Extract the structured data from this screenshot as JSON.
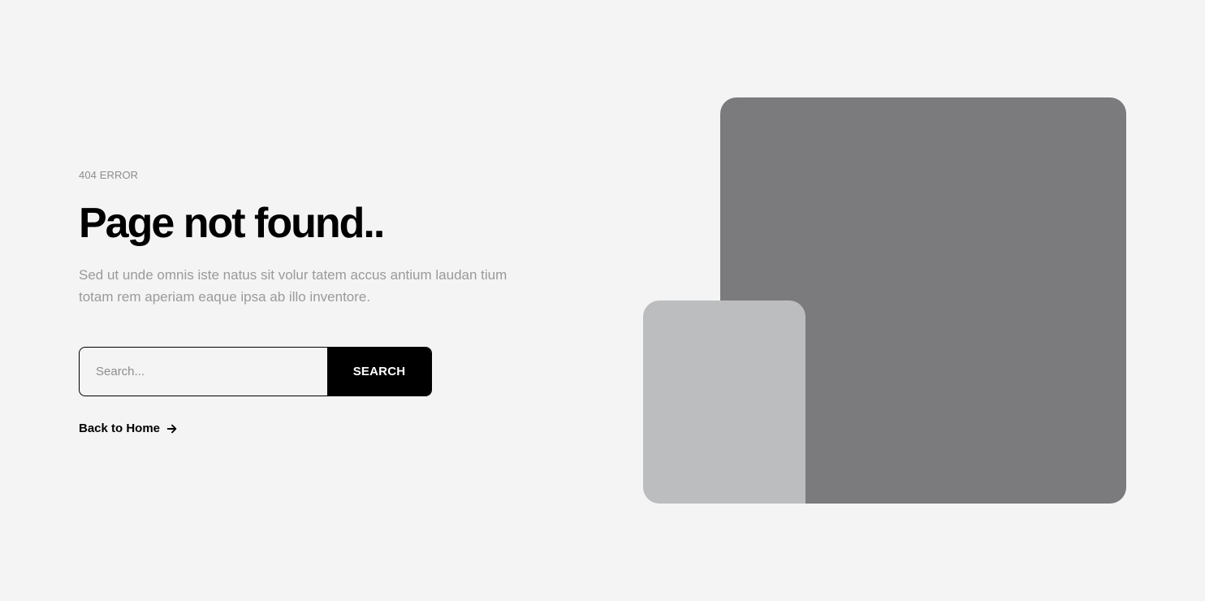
{
  "error": {
    "eyebrow": "404 ERROR",
    "title": "Page not found..",
    "description": "Sed ut unde omnis iste natus sit volur tatem accus antium laudan tium totam rem aperiam eaque ipsa ab illo inventore."
  },
  "search": {
    "placeholder": "Search...",
    "value": "",
    "button_label": "SEARCH"
  },
  "back_link": {
    "label": "Back to Home",
    "icon": "arrow-right-icon"
  },
  "illustration": {
    "large_color": "#7b7b7d",
    "small_color": "#bcbdbf"
  },
  "colors": {
    "background": "#f4f4f4",
    "text": "#000000",
    "muted": "#9a9a9a",
    "button": "#000000"
  }
}
